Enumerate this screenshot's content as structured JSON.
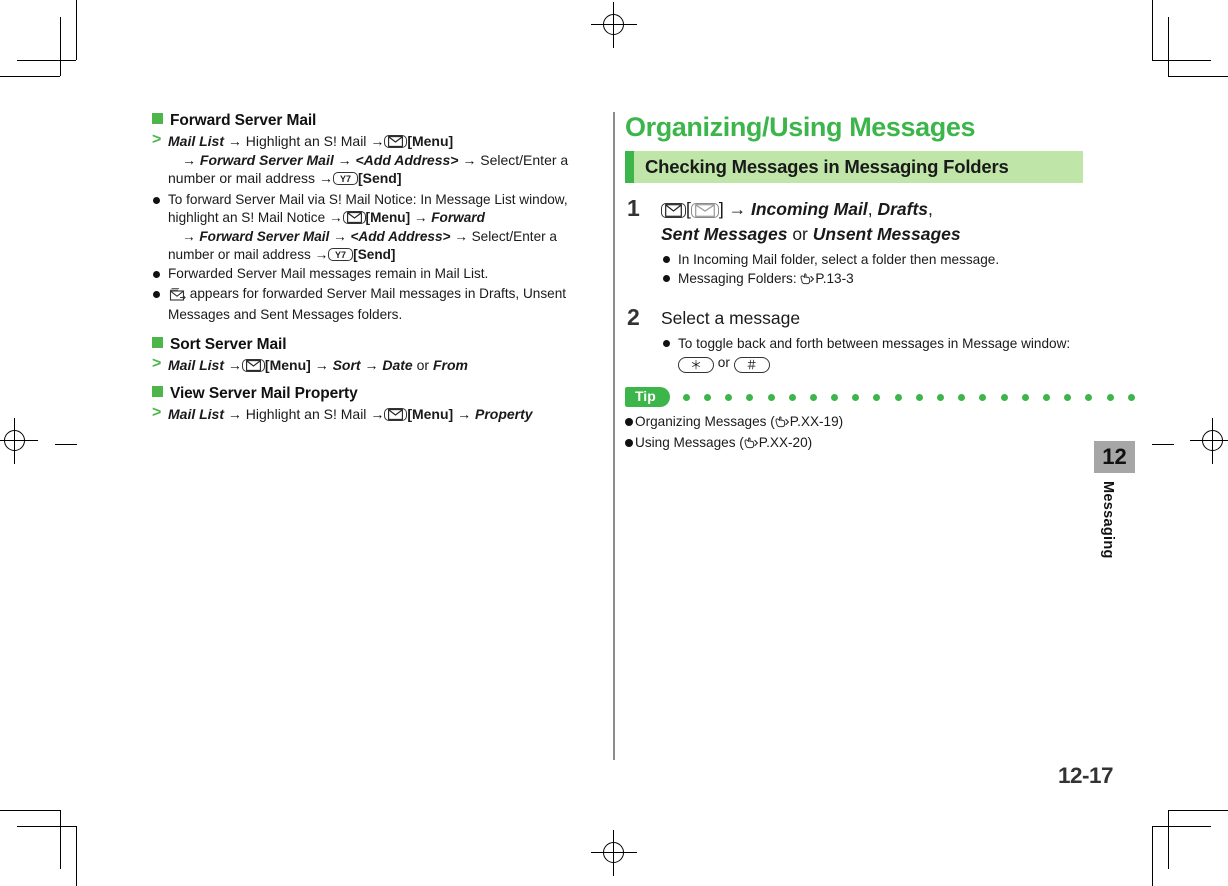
{
  "document": {
    "page_number": "12-17",
    "chapter_number": "12",
    "chapter_label": "Messaging"
  },
  "left_column": {
    "sections": [
      {
        "heading": "Forward Server Mail",
        "operation": {
          "lines": [
            "Mail List|bi",
            "arrow",
            "Highlight an S! Mail|n",
            "arrow",
            "icon-menu",
            "[Menu]|b",
            "break",
            "arrow",
            "Forward Server Mail|bi",
            "arrow",
            "<Add Address>|bi",
            "arrow",
            "Select/Enter a number or mail address|n",
            "arrow",
            "icon-send",
            "[Send]|b"
          ]
        },
        "bullets": [
          "To forward Server Mail via S! Mail Notice: In Message List window, highlight an S! Mail Notice",
          "Forwarded Server Mail messages remain in Mail List.",
          "appears for forwarded Server Mail messages in Drafts, Unsent Messages and Sent Messages folders."
        ]
      },
      {
        "heading": "Sort Server Mail"
      },
      {
        "heading": "View Server Mail Property"
      }
    ],
    "text": {
      "mail_list": "Mail List",
      "highlight_smail": "Highlight an S! Mail",
      "menu_label": "[Menu]",
      "forward_server_mail": "Forward Server Mail",
      "add_address": "<Add Address>",
      "select_enter": "Select/Enter a",
      "number_or_mail": "number or mail address",
      "send_label": "[Send]",
      "bullet1_l1": "To forward Server Mail via S! Mail Notice: In Message List window,",
      "bullet1_l2": "highlight an S! Mail Notice",
      "bullet1_forward": "Forward",
      "bullet2": "Forwarded Server Mail messages remain in Mail List.",
      "bullet3_l1": "appears for forwarded Server Mail messages in Drafts, Unsent",
      "bullet3_l2": "Messages and Sent Messages folders.",
      "sort_word": "Sort",
      "date_word": "Date",
      "or_word": "or",
      "from_word": "From",
      "property_word": "Property",
      "arrow_glyph": "→",
      "gt_glyph": ">"
    }
  },
  "right_column": {
    "title": "Organizing/Using Messages",
    "banner_title": "Checking Messages in Messaging Folders",
    "steps": [
      {
        "number": "1",
        "title_parts": {
          "incoming_mail": "Incoming Mail",
          "drafts": "Drafts",
          "sent_messages": "Sent Messages",
          "or": "or",
          "unsent_messages": "Unsent Messages"
        },
        "bullets": [
          "In Incoming Mail folder, select a folder then message.",
          "Messaging Folders:"
        ],
        "bullet2_ref": "P.13-3"
      },
      {
        "number": "2",
        "title": "Select a message",
        "bullets": [
          "To toggle back and forth between messages in Message window:"
        ],
        "keys": {
          "star": "＊",
          "hash": "＃",
          "or": "or"
        }
      }
    ],
    "tip": {
      "label": "Tip",
      "dot_count": 22,
      "items": [
        {
          "text": "Organizing Messages (",
          "ref": "P.XX-19",
          "close": ")"
        },
        {
          "text": "Using Messages (",
          "ref": "P.XX-20",
          "close": ")"
        }
      ]
    }
  },
  "colors": {
    "brand_green": "#3cb54a",
    "banner_green": "#bfe6a8",
    "square_green": "#4cb648",
    "tab_gray": "#a6a6a6"
  }
}
